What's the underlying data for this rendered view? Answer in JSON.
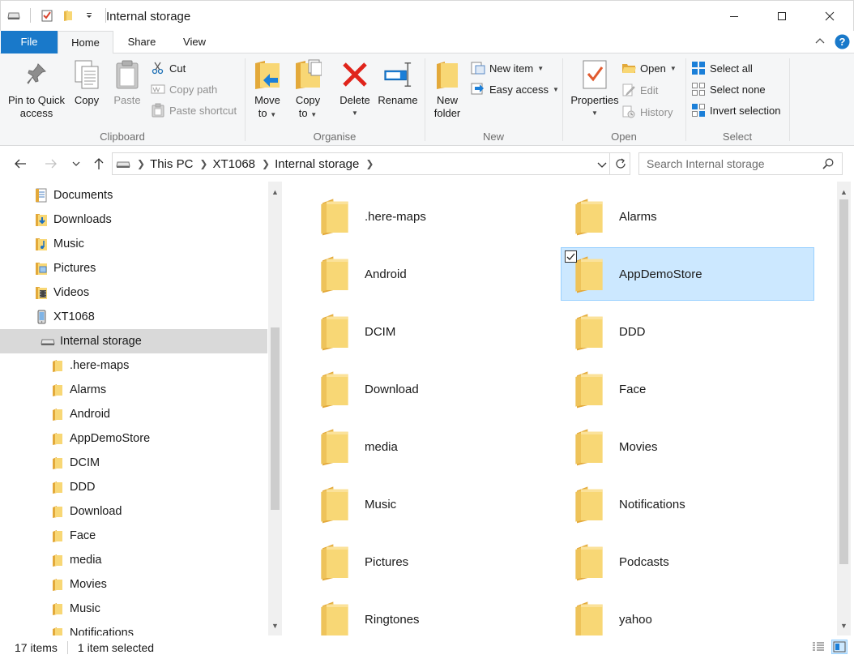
{
  "window": {
    "title": "Internal storage",
    "minimize_glyph": "—",
    "maximize_glyph": "☐",
    "close_glyph": "✕"
  },
  "tabs": {
    "file": "File",
    "home": "Home",
    "share": "Share",
    "view": "View"
  },
  "ribbon": {
    "clipboard": {
      "label": "Clipboard",
      "pin_line1": "Pin to Quick",
      "pin_line2": "access",
      "copy": "Copy",
      "paste": "Paste",
      "cut": "Cut",
      "copy_path": "Copy path",
      "paste_shortcut": "Paste shortcut"
    },
    "organise": {
      "label": "Organise",
      "move_line1": "Move",
      "move_line2": "to",
      "copyto_line1": "Copy",
      "copyto_line2": "to",
      "delete": "Delete",
      "rename": "Rename"
    },
    "new": {
      "label": "New",
      "newfolder_line1": "New",
      "newfolder_line2": "folder",
      "new_item": "New item",
      "easy_access": "Easy access"
    },
    "open": {
      "label": "Open",
      "properties": "Properties",
      "open": "Open",
      "edit": "Edit",
      "history": "History"
    },
    "select": {
      "label": "Select",
      "select_all": "Select all",
      "select_none": "Select none",
      "invert_selection": "Invert selection"
    }
  },
  "address": {
    "crumbs": [
      "This PC",
      "XT1068",
      "Internal storage"
    ],
    "search_placeholder": "Search Internal storage"
  },
  "nav_tree": [
    {
      "label": "Documents",
      "icon": "documents-icon",
      "indent": 0,
      "selected": false
    },
    {
      "label": "Downloads",
      "icon": "downloads-icon",
      "indent": 0,
      "selected": false
    },
    {
      "label": "Music",
      "icon": "music-icon",
      "indent": 0,
      "selected": false
    },
    {
      "label": "Pictures",
      "icon": "pictures-icon",
      "indent": 0,
      "selected": false
    },
    {
      "label": "Videos",
      "icon": "videos-icon",
      "indent": 0,
      "selected": false
    },
    {
      "label": "XT1068",
      "icon": "phone-icon",
      "indent": 0,
      "selected": false
    },
    {
      "label": "Internal storage",
      "icon": "drive-icon",
      "indent": 1,
      "selected": true
    },
    {
      "label": ".here-maps",
      "icon": "folder-icon",
      "indent": 2,
      "selected": false
    },
    {
      "label": "Alarms",
      "icon": "folder-icon",
      "indent": 2,
      "selected": false
    },
    {
      "label": "Android",
      "icon": "folder-icon",
      "indent": 2,
      "selected": false
    },
    {
      "label": "AppDemoStore",
      "icon": "folder-icon",
      "indent": 2,
      "selected": false
    },
    {
      "label": "DCIM",
      "icon": "folder-icon",
      "indent": 2,
      "selected": false
    },
    {
      "label": "DDD",
      "icon": "folder-icon",
      "indent": 2,
      "selected": false
    },
    {
      "label": "Download",
      "icon": "folder-icon",
      "indent": 2,
      "selected": false
    },
    {
      "label": "Face",
      "icon": "folder-icon",
      "indent": 2,
      "selected": false
    },
    {
      "label": "media",
      "icon": "folder-icon",
      "indent": 2,
      "selected": false
    },
    {
      "label": "Movies",
      "icon": "folder-icon",
      "indent": 2,
      "selected": false
    },
    {
      "label": "Music",
      "icon": "folder-icon",
      "indent": 2,
      "selected": false
    },
    {
      "label": "Notifications",
      "icon": "folder-icon",
      "indent": 2,
      "selected": false
    }
  ],
  "files": [
    {
      "name": ".here-maps",
      "selected": false
    },
    {
      "name": "Alarms",
      "selected": false
    },
    {
      "name": "Android",
      "selected": false
    },
    {
      "name": "AppDemoStore",
      "selected": true
    },
    {
      "name": "DCIM",
      "selected": false
    },
    {
      "name": "DDD",
      "selected": false
    },
    {
      "name": "Download",
      "selected": false
    },
    {
      "name": "Face",
      "selected": false
    },
    {
      "name": "media",
      "selected": false
    },
    {
      "name": "Movies",
      "selected": false
    },
    {
      "name": "Music",
      "selected": false
    },
    {
      "name": "Notifications",
      "selected": false
    },
    {
      "name": "Pictures",
      "selected": false
    },
    {
      "name": "Podcasts",
      "selected": false
    },
    {
      "name": "Ringtones",
      "selected": false
    },
    {
      "name": "yahoo",
      "selected": false
    }
  ],
  "status": {
    "item_count": "17 items",
    "selection": "1 item selected"
  },
  "colors": {
    "accent": "#1979ca",
    "selection_bg": "#cce8ff",
    "selection_border": "#99d1ff",
    "folder_yellow": "#f8d775"
  }
}
